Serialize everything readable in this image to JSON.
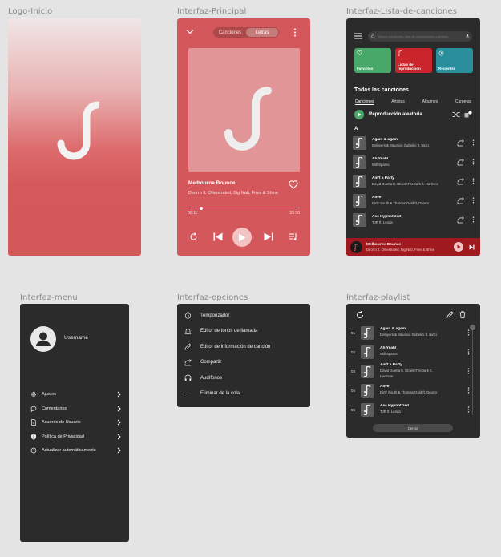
{
  "frames": {
    "logo": "Logo-Inicio",
    "main": "Interfaz-Principal",
    "list": "Interfaz-Lista-de-canciones",
    "menu": "Interfaz-menu",
    "options": "Interfaz-opciones",
    "playlist": "Interfaz-playlist"
  },
  "colors": {
    "accent": "#d4585b",
    "dark_bg": "#2b2b2b",
    "minibar": "#9e1a1f"
  },
  "player": {
    "tab_songs": "Canciones",
    "tab_lyrics": "Letras",
    "active_tab": "Letras",
    "title": "Melbourne Bounce",
    "artist": "Deorro ft. Orkestrated, Big Nab, Fries & Shine",
    "elapsed": "00:11",
    "duration": "22:50",
    "progress": 0.12
  },
  "list": {
    "search_placeholder": "Buscar canciones, lista de reproducción y artistas",
    "categories": [
      {
        "label": "Favoritos",
        "color": "#48a86a",
        "icon": "heart-icon"
      },
      {
        "label": "Listas de reproducción",
        "color": "#c9252b",
        "icon": "music-note-icon"
      },
      {
        "label": "Recientes",
        "color": "#2a8e9d",
        "icon": "history-icon"
      }
    ],
    "section_title": "Todas las canciones",
    "tabs": [
      "Canciones",
      "Artistas",
      "Albumes",
      "Carpetas"
    ],
    "shuffle_label": "Reproducción aleatoria",
    "letter": "A",
    "songs": [
      {
        "title": "Again & again",
        "artist": "Deluyers & Mauricio Gubelini ft. Nicci"
      },
      {
        "title": "Ah Yeah!",
        "artist": "Will Sparks"
      },
      {
        "title": "Ain't a Party",
        "artist": "David Guetta ft. GlowInTheDark ft. Harrison"
      },
      {
        "title": "Alive",
        "artist": "Dirty South & Thomas Gold ft. Deorro"
      },
      {
        "title": "Ass Hypnotized",
        "artist": "TJR ft. Lenda"
      }
    ],
    "now_playing": {
      "title": "Melbourne Bounce",
      "artist": "Deorro ft. Orkestrated, Big Nab, Fries & Shine"
    }
  },
  "menu": {
    "username": "Username",
    "items": [
      {
        "label": "Ajustes",
        "icon": "gear-icon"
      },
      {
        "label": "Comentarios",
        "icon": "comment-icon"
      },
      {
        "label": "Acuerdo de Usuario",
        "icon": "document-icon"
      },
      {
        "label": "Política de Privacidad",
        "icon": "shield-icon"
      },
      {
        "label": "Actualizar automáticamente",
        "icon": "refresh-clock-icon"
      }
    ]
  },
  "options": {
    "items": [
      {
        "label": "Temporizador",
        "icon": "timer-icon"
      },
      {
        "label": "Editor de tonos de llamada",
        "icon": "bell-icon"
      },
      {
        "label": "Editor de información de canción",
        "icon": "pencil-icon"
      },
      {
        "label": "Compartir",
        "icon": "share-icon"
      },
      {
        "label": "Audífonos",
        "icon": "headphones-icon"
      },
      {
        "label": "Eliminar de la cola",
        "icon": "minus-icon"
      }
    ]
  },
  "playlist": {
    "rows": [
      {
        "num": "01",
        "title": "Again & again",
        "artist": "Deluyers & Mauricio Gubelini ft. Nicci"
      },
      {
        "num": "02",
        "title": "Ah Yeah!",
        "artist": "Will Sparks"
      },
      {
        "num": "03",
        "title": "Ain't a Party",
        "artist": "David Guetta ft. GlowInTheDark ft. Harrison"
      },
      {
        "num": "04",
        "title": "Alive",
        "artist": "Dirty South & Thomas Gold ft. Deorro"
      },
      {
        "num": "05",
        "title": "Ass Hypnotized",
        "artist": "TJR ft. Lenda"
      }
    ],
    "close_label": "Cerrar"
  }
}
